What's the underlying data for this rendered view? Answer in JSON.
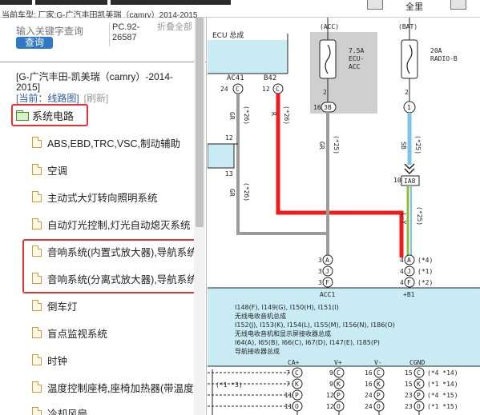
{
  "topbar": {
    "car_info": "当前车型:  厂家:G-广汽丰田凯美瑞（camry）2014-2015",
    "tool_label": "全里"
  },
  "search": {
    "placeholder": "输入关键字查询",
    "button": "查询",
    "pc_code": "PC.92-26587",
    "fold_all": "折叠全部"
  },
  "tree": {
    "title": "[G-广汽丰田-凯美瑞（camry）-2014-2015]",
    "current_label": "[当前：线路图]",
    "refresh_label": "[刷新]",
    "root": "系统电路",
    "items": [
      "ABS,EBD,TRC,VSC,制动辅助",
      "空调",
      "主动式大灯转向照明系统",
      "自动灯光控制,灯光自动熄灭系统",
      "音响系统(内置式放大器),导航系统",
      "音响系统(分离式放大器),导航系统",
      "倒车灯",
      "盲点监视系统",
      "时钟",
      "温度控制座椅,座椅加热器(带温度",
      "冷却风扇"
    ]
  },
  "diagram": {
    "ecu_label": "ECU 总成",
    "acc_title": "(ACC)",
    "bat_title": "(BAT)",
    "fuse_acc": [
      "7.5A",
      "ECU-",
      "ACC"
    ],
    "fuse_bat": [
      "20A",
      "RADIO-B"
    ],
    "connectors": {
      "ac41": "AC41",
      "b42": "B42",
      "c3b": "3B",
      "c1": "1",
      "ia8": "IA8"
    },
    "pin_labels": {
      "p24": "24",
      "p12a": "12",
      "p2a": "2",
      "p16": "16",
      "p2b": "2",
      "p12b": "12",
      "p13": "13",
      "p10": "10"
    },
    "wire_colors": {
      "gr": "GR",
      "r": "R",
      "sb": "SB",
      "ly": "L-Y"
    },
    "star26": "(*26)",
    "star25": "(*25)",
    "left_pins": [
      {
        "num": "3",
        "letter": "A"
      },
      {
        "num": "3",
        "letter": "J"
      },
      {
        "num": "3",
        "letter": "F"
      }
    ],
    "right_pins": [
      {
        "num": "4",
        "letter": "A",
        "note": "(*4)"
      },
      {
        "num": "4",
        "letter": "J",
        "note": "(*1)"
      },
      {
        "num": "4",
        "letter": "F",
        "note": "(*2)"
      }
    ],
    "acc1": "ACC1",
    "b1": "+B1",
    "radio_lines": [
      "I148(F), I149(G), I150(H), I151(I)",
      "无线电收音机总成",
      "I152(J), I153(K), I154(L), I155(M), I156(N), I186(O)",
      "无线电收音机和显示屏接收器总成",
      "I64(A), I65(B), I66(C), I67(D), I147(E), I185(P)",
      "导航接收器总成"
    ],
    "bottom_headers": [
      "CA+",
      "V+",
      "V-",
      "CGND"
    ],
    "bottom_left_note": "(*1 *3)",
    "bottom_rows": [
      {
        "a": "7",
        "al": "C",
        "b": "9",
        "bl": "C",
        "c": "16",
        "cl": "C",
        "d": "15",
        "dl": "C",
        "note": "(*4 *14)"
      },
      {
        "a": "7",
        "al": "K",
        "b": "9",
        "bl": "K",
        "c": "16",
        "cl": "K",
        "d": "15",
        "dl": "K",
        "note": "(*1 *14)"
      },
      {
        "a": "11",
        "al": "P",
        "b": "12",
        "bl": "P",
        "c": "24",
        "cl": "P",
        "d": "23",
        "dl": "P",
        "note": "(*4 *15)"
      },
      {
        "a": "11",
        "al": "O",
        "b": "12",
        "bl": "O",
        "c": "24",
        "cl": "O",
        "d": "23",
        "dl": "O",
        "note": "(*1 *15)"
      }
    ],
    "colors": {
      "red": "#ee1c1c",
      "gray": "#9b9b9b",
      "blue": "#7ec4e6",
      "yellowgreen": "#8fbf3a",
      "box": "#c9ecf4"
    }
  }
}
